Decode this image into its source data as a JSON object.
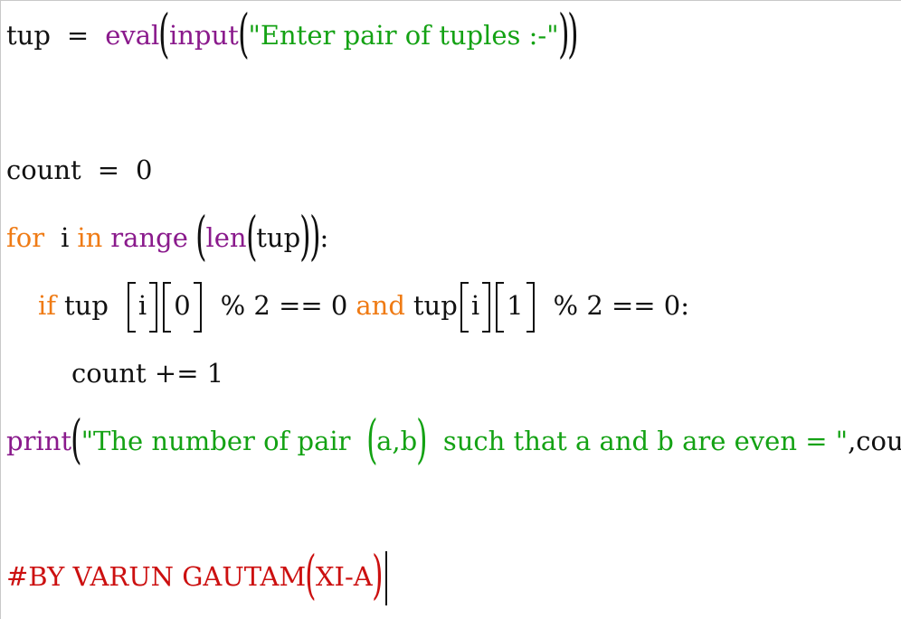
{
  "editor": {
    "line1": {
      "var": "tup",
      "assign": "=",
      "eval": "eval",
      "input": "input",
      "prompt": "\"Enter pair of tuples :-\""
    },
    "line2": {
      "var": "count",
      "assign": "=",
      "value": "0"
    },
    "line3": {
      "for": "for",
      "iter": "i",
      "in": "in",
      "range": "range",
      "len": "len",
      "arg": "tup",
      "colon": ":"
    },
    "line4": {
      "if": "if",
      "var1": "tup",
      "idx_i1": "i",
      "idx_01": "0",
      "mod1": "% 2 == 0",
      "and": "and",
      "var2": "tup",
      "idx_i2": "i",
      "idx_12": "1",
      "mod2": "% 2 == 0:"
    },
    "line5": {
      "stmt": "count += 1"
    },
    "line6": {
      "print": "print",
      "str_a": "\"The number of pair",
      "pair": "a,b",
      "str_b": "such that a and b are even = \"",
      "rest": ",count"
    },
    "line7": {
      "comment": "#BY VARUN GAUTAM",
      "class": "XI-A"
    }
  },
  "colors": {
    "keyword": "#ef7b15",
    "function": "#8a1a8c",
    "string": "#14a214",
    "comment": "#cc1010",
    "text": "#111111"
  }
}
